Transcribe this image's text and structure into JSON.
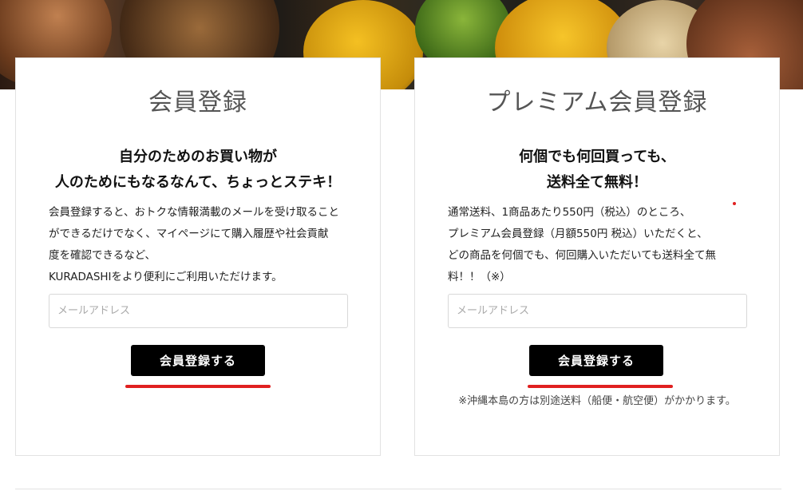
{
  "member": {
    "title": "会員登録",
    "catch_line1": "自分のためのお買い物が",
    "catch_line2": "人のためにもなるなんて、ちょっとステキ！",
    "desc_line1": "会員登録すると、おトクな情報満載のメールを受け取ること",
    "desc_line2": "ができるだけでなく、マイページにて購入履歴や社会貢献",
    "desc_line3": "度を確認できるなど、",
    "desc_line4": "KURADASHIをより便利にご利用いただけます。",
    "email_placeholder": "メールアドレス",
    "button_label": "会員登録する"
  },
  "premium": {
    "title": "プレミアム会員登録",
    "catch_line1": "何個でも何回買っても、",
    "catch_line2": "送料全て無料！",
    "desc_line1": "通常送料、1商品あたり550円（税込）のところ、",
    "desc_line2": "プレミアム会員登録（月額550円 税込）いただくと、",
    "desc_line3": "どの商品を何個でも、何回購入いただいても送料全て無",
    "desc_line4": "料！！（※）",
    "email_placeholder": "メールアドレス",
    "button_label": "会員登録する",
    "note": "※沖縄本島の方は別途送料（船便・航空便）がかかります。"
  },
  "colors": {
    "accent_red": "#e02020",
    "button_black": "#000000"
  }
}
